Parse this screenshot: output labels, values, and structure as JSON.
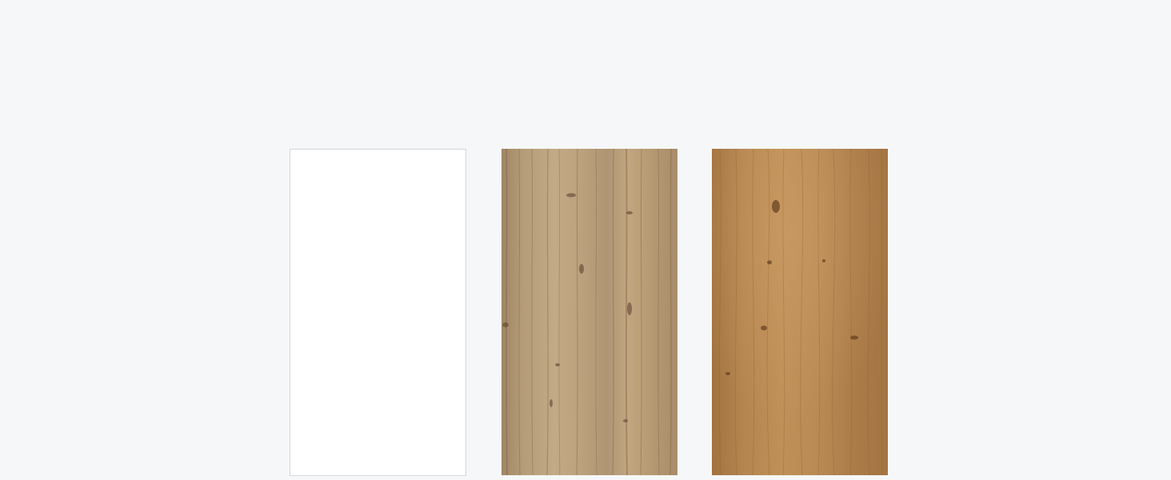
{
  "swatches": [
    {
      "icon": "white-finish-swatch",
      "color": "#ffffff"
    },
    {
      "icon": "light-oak-wood-swatch",
      "color": "#b79a73"
    },
    {
      "icon": "honey-oak-wood-swatch",
      "color": "#b3834f"
    }
  ]
}
